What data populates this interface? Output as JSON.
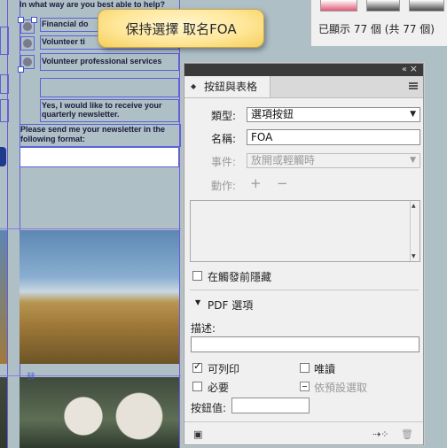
{
  "document": {
    "question_line": "In what way are you best able to help?",
    "options": [
      "Financial do",
      "Volunteer ti",
      "Volunteer professional services"
    ],
    "newsletter_line1": "Yes, I would like to receive your",
    "newsletter_line2": "quarterly newsletter.",
    "format_line1": "Please send me your newsletter in the",
    "format_line2": "following format:"
  },
  "tooltip": {
    "text": "保持選擇 取名FOA"
  },
  "top_right": {
    "status": "已顯示 77 個 (共 77 個)"
  },
  "panel": {
    "tab_title": "按鈕與表格",
    "type_label": "類型:",
    "type_value": "選項按鈕",
    "name_label": "名稱:",
    "name_value": "FOA",
    "event_label": "事件:",
    "event_value": "放開或輕觸時",
    "action_label": "動作:",
    "add_action": "+",
    "remove_action": "−",
    "hide_until_triggered": "在觸發前隱藏",
    "pdf_options_title": "PDF 選項",
    "description_label": "描述:",
    "description_value": "",
    "printable_label": "可列印",
    "printable_checked": true,
    "readonly_label": "唯讀",
    "readonly_checked": false,
    "required_label": "必要",
    "required_checked": false,
    "default_selected_label": "依預設選取",
    "button_value_label": "按鈕值:",
    "button_value": ""
  },
  "colors": {
    "guide": "#6b5bd6",
    "tooltip": "#ffe79a",
    "panel_bg": "#f0f0f0"
  }
}
